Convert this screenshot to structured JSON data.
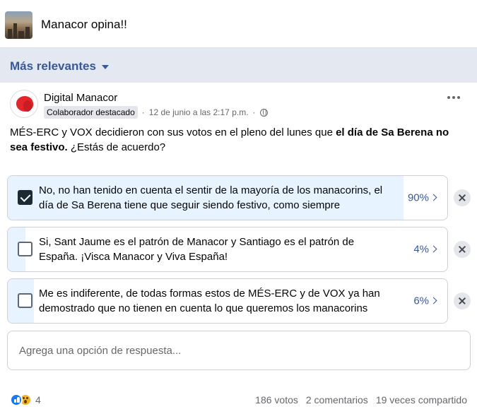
{
  "group": {
    "name": "Manacor opina!!"
  },
  "sort": {
    "label": "Más relevantes"
  },
  "post": {
    "author": "Digital Manacor",
    "badge": "Colaborador destacado",
    "dot1": "·",
    "timestamp": "12 de junio a las 2:17 p.m.",
    "dot2": "·",
    "text_a": "MÉS-ERC y VOX decidieron con sus votos en el pleno del lunes que ",
    "text_bold": "el día de Sa Berena no sea festivo.",
    "text_b": " ¿Estás de acuerdo?"
  },
  "poll": {
    "options": [
      {
        "label": "No, no han tenido en cuenta el sentir de la mayoría de los manacorins, el día de Sa Berena tiene que seguir siendo festivo, como siempre",
        "percent": "90%",
        "share": 0.9,
        "checked": true
      },
      {
        "label": "Si, Sant Jaume es el patrón de Manacor y Santiago es el patrón de España. ¡Visca Manacor y Viva España!",
        "percent": "4%",
        "share": 0.04,
        "checked": false
      },
      {
        "label": "Me es indiferente, de todas formas estos de MÉS-ERC y de VOX ya han demostrado que no tienen en cuenta lo que queremos los manacorins",
        "percent": "6%",
        "share": 0.06,
        "checked": false
      }
    ],
    "add_placeholder": "Agrega una opción de respuesta..."
  },
  "footer": {
    "reaction_count": "4",
    "votes": "186 votos",
    "comments": "2 comentarios",
    "shares": "19 veces compartido"
  },
  "colors": {
    "accent": "#385898",
    "fill": "#e7f3ff",
    "band": "#e4e9f1"
  }
}
